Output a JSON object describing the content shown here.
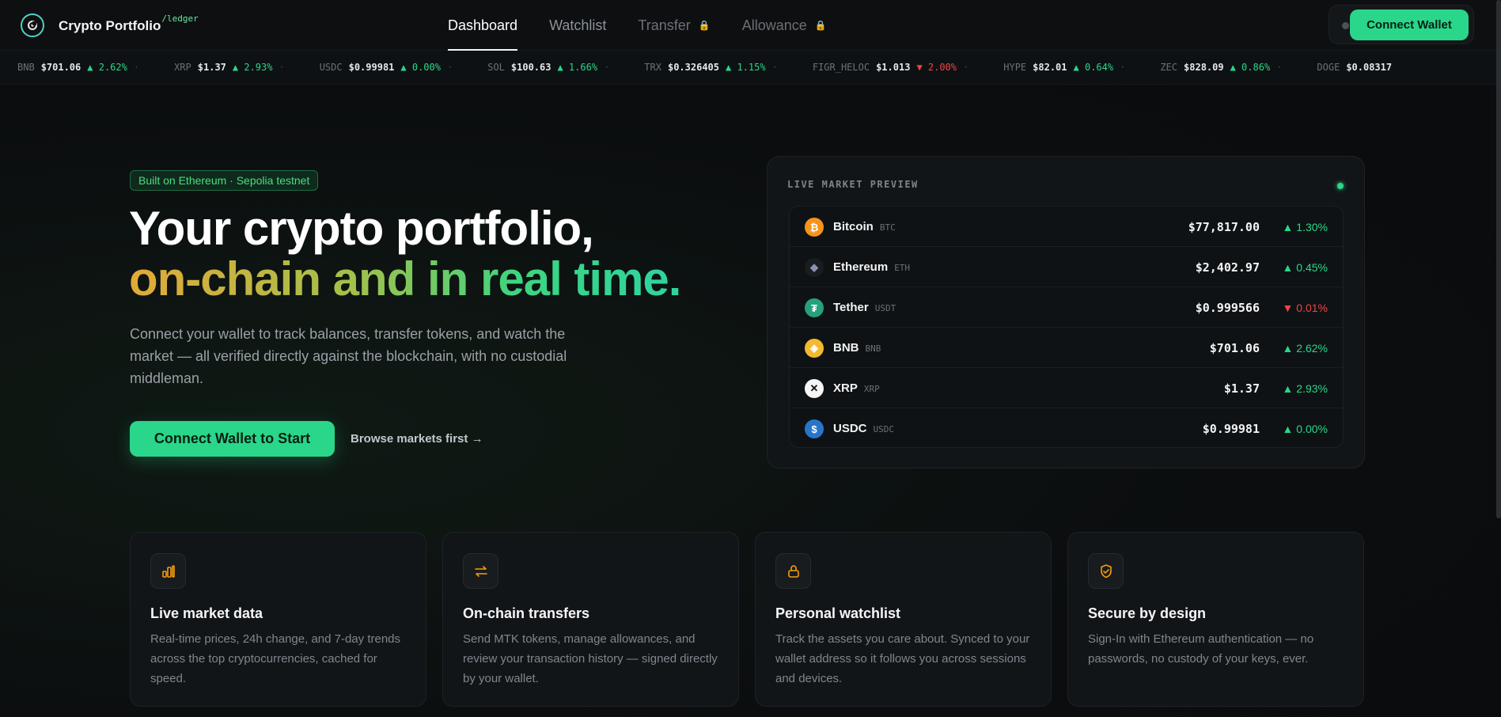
{
  "brand": {
    "name": "Crypto Portfolio",
    "sub": "/ledger"
  },
  "nav": {
    "tabs": [
      {
        "label": "Dashboard"
      },
      {
        "label": "Watchlist"
      },
      {
        "label": "Transfer"
      },
      {
        "label": "Allowance"
      }
    ],
    "connect_label": "Connect Wallet"
  },
  "ticker": [
    {
      "sym": "BNB",
      "price": "$701.06",
      "chg": "▲ 2.62%",
      "dir": "up"
    },
    {
      "sym": "XRP",
      "price": "$1.37",
      "chg": "▲ 2.93%",
      "dir": "up"
    },
    {
      "sym": "USDC",
      "price": "$0.99981",
      "chg": "▲ 0.00%",
      "dir": "up"
    },
    {
      "sym": "SOL",
      "price": "$100.63",
      "chg": "▲ 1.66%",
      "dir": "up"
    },
    {
      "sym": "TRX",
      "price": "$0.326405",
      "chg": "▲ 1.15%",
      "dir": "up"
    },
    {
      "sym": "FIGR_HELOC",
      "price": "$1.013",
      "chg": "▼ 2.00%",
      "dir": "down"
    },
    {
      "sym": "HYPE",
      "price": "$82.01",
      "chg": "▲ 0.64%",
      "dir": "up"
    },
    {
      "sym": "ZEC",
      "price": "$828.09",
      "chg": "▲ 0.86%",
      "dir": "up"
    },
    {
      "sym": "DOGE",
      "price": "$0.08317",
      "chg": "",
      "dir": "up"
    }
  ],
  "hero": {
    "badge": "Built on Ethereum · Sepolia testnet",
    "title_line1": "Your crypto portfolio,",
    "title_line2": "on-chain and in real time.",
    "lead": "Connect your wallet to track balances, transfer tokens, and watch the market — all verified directly against the blockchain, with no custodial middleman.",
    "cta": "Connect Wallet to Start",
    "browse": "Browse markets first →"
  },
  "market": {
    "title": "LIVE MARKET PREVIEW",
    "rows": [
      {
        "name": "Bitcoin",
        "sym": "BTC",
        "price": "$77,817.00",
        "chg": "▲ 1.30%",
        "dir": "up",
        "icon": "bitcoin-icon",
        "color": "#f7931a",
        "glyph": "₿"
      },
      {
        "name": "Ethereum",
        "sym": "ETH",
        "price": "$2,402.97",
        "chg": "▲ 0.45%",
        "dir": "up",
        "icon": "ethereum-icon",
        "color": "#1a1d20",
        "glyph": "◆"
      },
      {
        "name": "Tether",
        "sym": "USDT",
        "price": "$0.999566",
        "chg": "▼ 0.01%",
        "dir": "down",
        "icon": "tether-icon",
        "color": "#26a17b",
        "glyph": "₮"
      },
      {
        "name": "BNB",
        "sym": "BNB",
        "price": "$701.06",
        "chg": "▲ 2.62%",
        "dir": "up",
        "icon": "bnb-icon",
        "color": "#f3ba2f",
        "glyph": "◈"
      },
      {
        "name": "XRP",
        "sym": "XRP",
        "price": "$1.37",
        "chg": "▲ 2.93%",
        "dir": "up",
        "icon": "xrp-icon",
        "color": "#f5f5f5",
        "glyph": "✕"
      },
      {
        "name": "USDC",
        "sym": "USDC",
        "price": "$0.99981",
        "chg": "▲ 0.00%",
        "dir": "up",
        "icon": "usdc-icon",
        "color": "#2775ca",
        "glyph": "$"
      }
    ]
  },
  "features": [
    {
      "title": "Live market data",
      "text": "Real-time prices, 24h change, and 7-day trends across the top cryptocurrencies, cached for speed.",
      "icon": "bar-chart-icon"
    },
    {
      "title": "On-chain transfers",
      "text": "Send MTK tokens, manage allowances, and review your transaction history — signed directly by your wallet.",
      "icon": "transfer-arrows-icon"
    },
    {
      "title": "Personal watchlist",
      "text": "Track the assets you care about. Synced to your wallet address so it follows you across sessions and devices.",
      "icon": "lock-icon"
    },
    {
      "title": "Secure by design",
      "text": "Sign-In with Ethereum authentication — no passwords, no custody of your keys, ever.",
      "icon": "shield-check-icon"
    }
  ],
  "colors": {
    "accent": "#2ad68a",
    "down": "#ef4444",
    "bg": "#0b0d0f"
  }
}
